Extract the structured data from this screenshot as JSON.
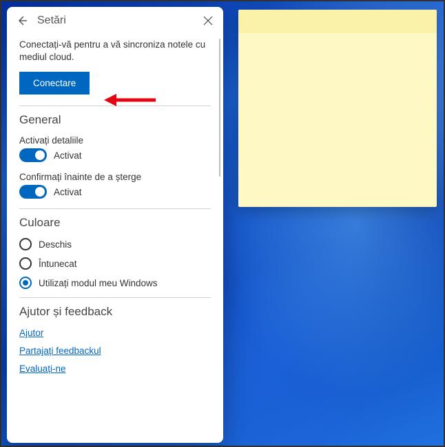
{
  "header": {
    "title": "Setări"
  },
  "sync": {
    "description": "Conectați-vă pentru a vă sincroniza notele cu mediul cloud.",
    "connect_label": "Conectare"
  },
  "general": {
    "title": "General",
    "insights": {
      "label": "Activați detaliile",
      "state": "Activat",
      "on": true
    },
    "confirm_delete": {
      "label": "Confirmați înainte de a șterge",
      "state": "Activat",
      "on": true
    }
  },
  "color": {
    "title": "Culoare",
    "options": [
      {
        "label": "Deschis",
        "selected": false
      },
      {
        "label": "Întunecat",
        "selected": false
      },
      {
        "label": "Utilizați modul meu Windows",
        "selected": true
      }
    ]
  },
  "help": {
    "title": "Ajutor și feedback",
    "links": {
      "help": "Ajutor",
      "feedback": "Partajați feedbackul",
      "rate": "Evaluați-ne"
    }
  },
  "colors": {
    "accent": "#0067c0"
  }
}
